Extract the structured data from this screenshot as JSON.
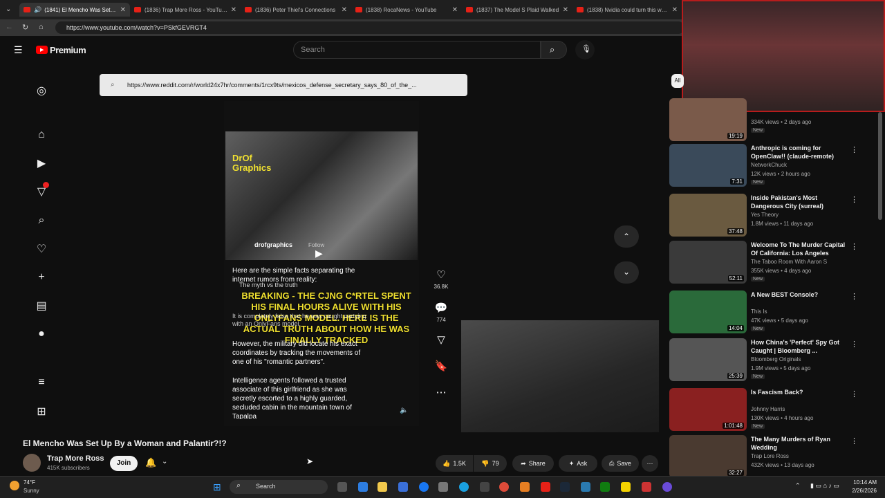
{
  "browser": {
    "tabs": [
      {
        "title": "(1841) El Mencho Was Set Up",
        "active": true
      },
      {
        "title": "(1836) Trap More Ross - YouTube"
      },
      {
        "title": "(1836) Peter Thiel's Connections"
      },
      {
        "title": "(1838) RocaNews - YouTube"
      },
      {
        "title": "(1837) The Model S Plaid Walked"
      },
      {
        "title": "(1838) Nvidia could turn this whole"
      }
    ],
    "url": "https://www.youtube.com/watch?v=PSkfGEVRGT4"
  },
  "youtube": {
    "brand": "Premium",
    "search_placeholder": "Search"
  },
  "popup": {
    "url": "https://www.reddit.com/r/world24x7hr/comments/1rcx9ts/mexicos_defense_secretary_says_80_of_the_..."
  },
  "short": {
    "brand": "DrOf Graphics",
    "handle": "drofgraphics",
    "follow": "Follow",
    "intro": "Here are the simple facts separating the internet rumors from reality:",
    "breaking": "BREAKING - THE CJNG C*RTEL SPENT HIS FINAL HOURS ALIVE WITH HIS ONLYFANS MODEL. HERE IS THE ACTUAL TRUTH ABOUT HOW HE WAS FINALLY TRACKED",
    "myth": "The myth vs the truth",
    "p1": "It is completely false that he was caught partying with an OnlyFans model.",
    "p2": "However, the military did locate his exact coordinates by tracking the movements of one of his \"romantic partners\".",
    "p3": "Intelligence agents followed a trusted associate of this girlfriend as she was secretly escorted to a highly guarded, secluded cabin in the mountain town of Tapalpa",
    "likes": "36.8K",
    "comments": "774"
  },
  "video": {
    "title": "El Mencho Was Set Up By a Woman and Palantir?!?",
    "channel": "Trap More Ross",
    "subscribers": "415K subscribers",
    "join": "Join",
    "likes": "1.5K",
    "dislikes": "79",
    "share": "Share",
    "ask": "Ask",
    "save": "Save"
  },
  "chip_all": "All",
  "recommendations": [
    {
      "title": "",
      "channel": "",
      "meta": "334K views • 2 days ago",
      "badge": "New",
      "duration": "19:19",
      "color": "#7a5a4a"
    },
    {
      "title": "Anthropic is coming for OpenClaw!! (claude-remote)",
      "channel": "NetworkChuck",
      "meta": "12K views • 2 hours ago",
      "badge": "New",
      "duration": "7:31",
      "color": "#3a4a5a"
    },
    {
      "title": "Inside Pakistan's Most Dangerous City (surreal)",
      "channel": "Yes Theory",
      "meta": "1.8M views • 11 days ago",
      "badge": "",
      "duration": "37:48",
      "color": "#6a5a40"
    },
    {
      "title": "Welcome To The Murder Capital Of California: Los Angeles",
      "channel": "The Taboo Room With Aaron S",
      "meta": "355K views • 4 days ago",
      "badge": "New",
      "duration": "52:11",
      "color": "#3a3a3a"
    },
    {
      "title": "A New BEST Console?",
      "channel": "This Is",
      "meta": "47K views • 5 days ago",
      "badge": "New",
      "duration": "14:04",
      "color": "#2a6a3a"
    },
    {
      "title": "How China's 'Perfect' Spy Got Caught | Bloomberg ...",
      "channel": "Bloomberg Originals",
      "meta": "1.9M views • 5 days ago",
      "badge": "New",
      "duration": "25:39",
      "color": "#555555"
    },
    {
      "title": "Is Fascism Back?",
      "channel": "Johnny Harris",
      "meta": "130K views • 4 hours ago",
      "badge": "New",
      "duration": "1:01:48",
      "color": "#8a2020"
    },
    {
      "title": "The Many Murders of Ryan Wedding",
      "channel": "Trap Lore Ross",
      "meta": "432K views • 13 days ago",
      "badge": "",
      "duration": "32:27",
      "color": "#4a3a30"
    }
  ],
  "taskbar": {
    "temp": "74°F",
    "weather": "Sunny",
    "search": "Search",
    "time": "10:14 AM",
    "date": "2/26/2026"
  },
  "colors": {
    "youtube_red": "#ff0000",
    "background": "#0f0f0f",
    "breaking_text": "#f0e030"
  }
}
